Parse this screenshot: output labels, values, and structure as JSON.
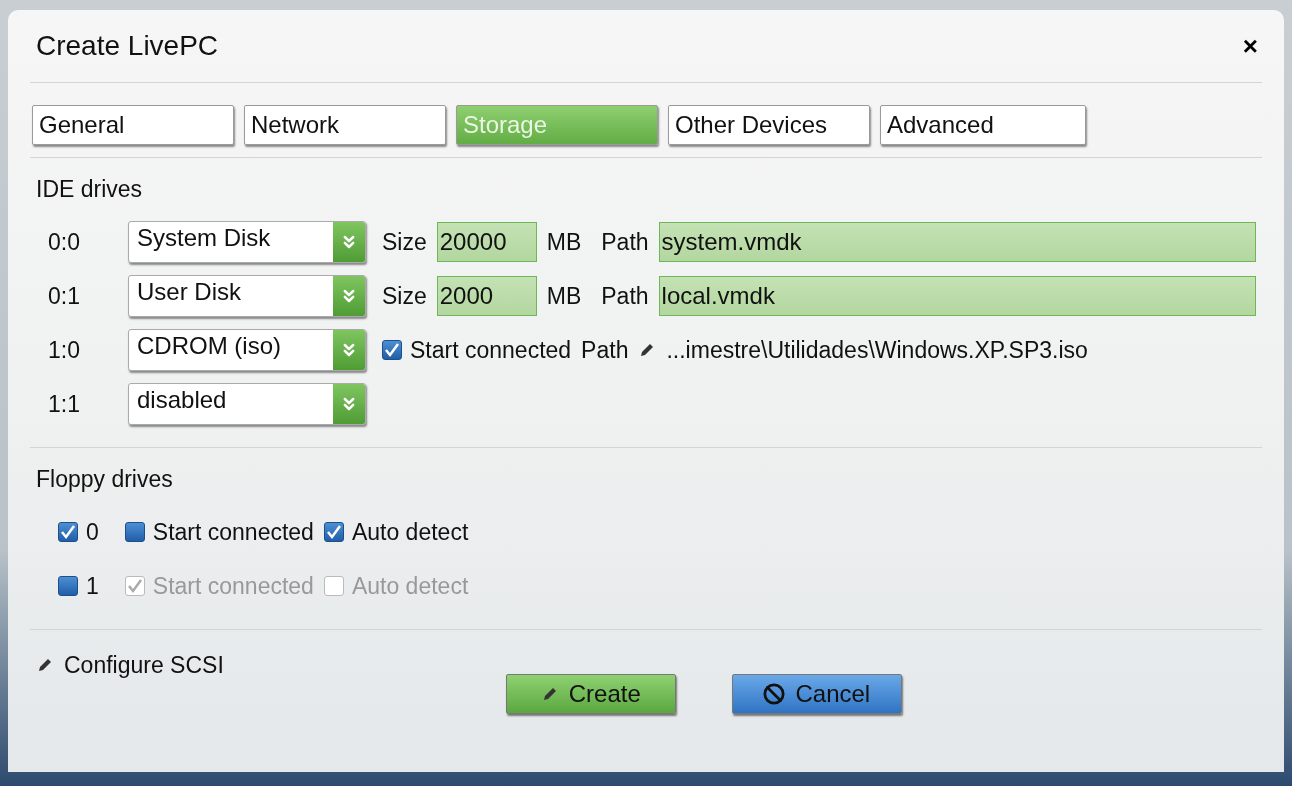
{
  "dialog": {
    "title": "Create LivePC",
    "close": "×"
  },
  "tabs": [
    {
      "label": "General",
      "selected": false
    },
    {
      "label": "Network",
      "selected": false
    },
    {
      "label": "Storage",
      "selected": true
    },
    {
      "label": "Other Devices",
      "selected": false
    },
    {
      "label": "Advanced",
      "selected": false
    }
  ],
  "ide": {
    "title": "IDE drives",
    "drives": [
      {
        "kind": "disk",
        "slot": "0:0",
        "type": "System Disk",
        "size_label": "Size",
        "size": "20000",
        "unit": "MB",
        "path_label": "Path",
        "path": "system.vmdk"
      },
      {
        "kind": "disk",
        "slot": "0:1",
        "type": "User Disk",
        "size_label": "Size",
        "size": "2000",
        "unit": "MB",
        "path_label": "Path",
        "path": "local.vmdk"
      },
      {
        "kind": "cdrom",
        "slot": "1:0",
        "type": "CDROM (iso)",
        "start_connected": {
          "label": "Start connected",
          "checked": true
        },
        "path_label": "Path",
        "path": "...imestre\\Utilidades\\Windows.XP.SP3.iso"
      },
      {
        "kind": "none",
        "slot": "1:1",
        "type": "disabled"
      }
    ]
  },
  "floppy": {
    "title": "Floppy drives",
    "drives": [
      {
        "label": "0",
        "checked": true,
        "start_connected": {
          "label": "Start connected",
          "checked": false,
          "disabled": false
        },
        "auto_detect": {
          "label": "Auto detect",
          "checked": true,
          "disabled": false
        }
      },
      {
        "label": "1",
        "checked": false,
        "start_connected": {
          "label": "Start connected",
          "checked": true,
          "disabled": true
        },
        "auto_detect": {
          "label": "Auto detect",
          "checked": false,
          "disabled": true
        }
      }
    ]
  },
  "configure_scsi": "Configure SCSI",
  "buttons": [
    {
      "kind": "create",
      "label": "Create"
    },
    {
      "kind": "cancel",
      "label": "Cancel"
    }
  ]
}
